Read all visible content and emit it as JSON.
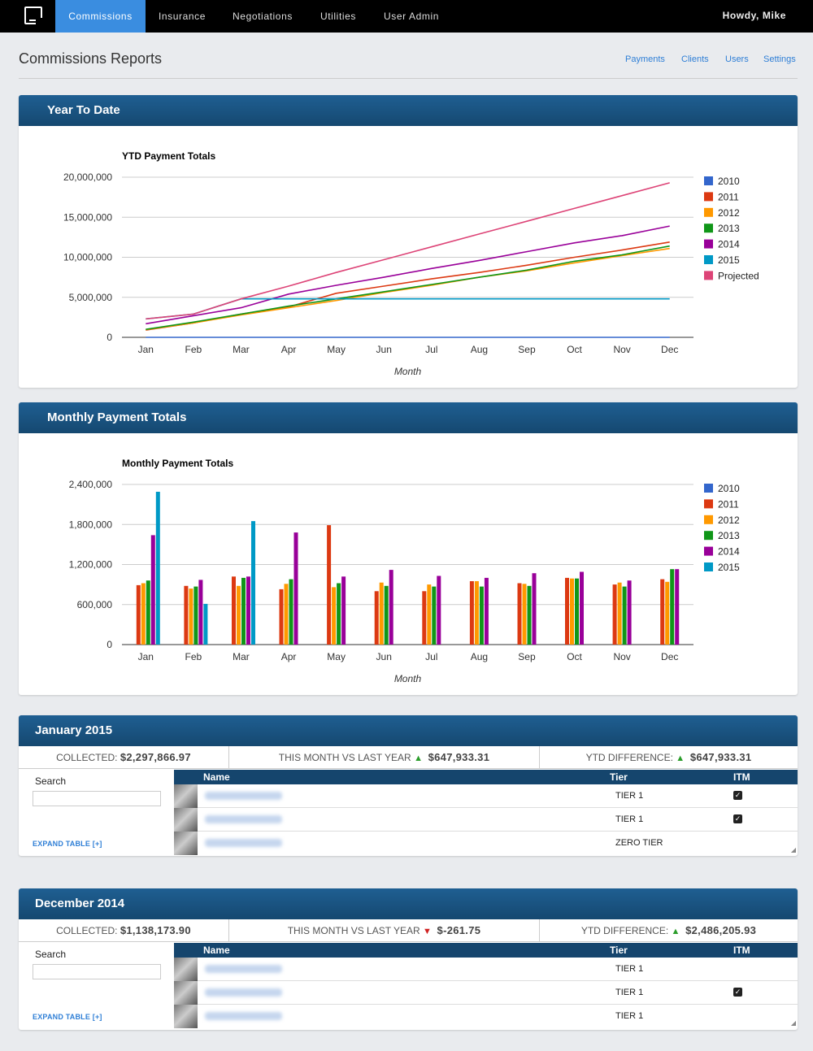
{
  "nav": {
    "items": [
      "Commissions",
      "Insurance",
      "Negotiations",
      "Utilities",
      "User Admin"
    ],
    "greeting": "Howdy, Mike"
  },
  "header": {
    "title": "Commissions Reports",
    "links": [
      "Payments",
      "Clients",
      "Users",
      "Settings"
    ]
  },
  "colors": {
    "2010": "#3366cc",
    "2011": "#dc3912",
    "2012": "#ff9900",
    "2013": "#109618",
    "2014": "#990099",
    "2015": "#0099c6",
    "Projected": "#dd4477"
  },
  "ytd_panel": {
    "title": "Year To Date"
  },
  "monthly_panel": {
    "title": "Monthly Payment Totals"
  },
  "chart_data": [
    {
      "type": "line",
      "title": "YTD Payment Totals",
      "xlabel": "Month",
      "ylabel": "",
      "categories": [
        "Jan",
        "Feb",
        "Mar",
        "Apr",
        "May",
        "Jun",
        "Jul",
        "Aug",
        "Sep",
        "Oct",
        "Nov",
        "Dec"
      ],
      "ylim": [
        0,
        20000000
      ],
      "yticks": [
        0,
        5000000,
        10000000,
        15000000,
        20000000
      ],
      "ytick_labels": [
        "0",
        "5,000,000",
        "10,000,000",
        "15,000,000",
        "20,000,000"
      ],
      "legend": "right",
      "series": [
        {
          "name": "2010",
          "values": [
            0,
            0,
            0,
            0,
            0,
            0,
            0,
            0,
            0,
            0,
            0,
            0
          ]
        },
        {
          "name": "2011",
          "values": [
            900000,
            1800000,
            2900000,
            3800000,
            5500000,
            6400000,
            7300000,
            8100000,
            9000000,
            10000000,
            10900000,
            11900000
          ]
        },
        {
          "name": "2012",
          "values": [
            950000,
            1800000,
            2800000,
            3700000,
            4600000,
            5600000,
            6500000,
            7500000,
            8300000,
            9300000,
            10200000,
            11100000
          ]
        },
        {
          "name": "2013",
          "values": [
            1000000,
            1900000,
            2900000,
            3900000,
            4800000,
            5700000,
            6600000,
            7500000,
            8400000,
            9500000,
            10300000,
            11400000
          ]
        },
        {
          "name": "2014",
          "values": [
            1700000,
            2700000,
            3700000,
            5400000,
            6500000,
            7500000,
            8600000,
            9600000,
            10700000,
            11800000,
            12700000,
            13900000
          ]
        },
        {
          "name": "2015",
          "values": [
            2300000,
            2900000,
            4800000,
            4800000,
            4800000,
            4800000,
            4800000,
            4800000,
            4800000,
            4800000,
            4800000,
            4800000
          ]
        },
        {
          "name": "Projected",
          "values": [
            2300000,
            2900000,
            4800000,
            6400000,
            8100000,
            9700000,
            11300000,
            12900000,
            14500000,
            16100000,
            17700000,
            19300000
          ]
        }
      ]
    },
    {
      "type": "bar",
      "title": "Monthly Payment Totals",
      "xlabel": "Month",
      "ylabel": "",
      "categories": [
        "Jan",
        "Feb",
        "Mar",
        "Apr",
        "May",
        "Jun",
        "Jul",
        "Aug",
        "Sep",
        "Oct",
        "Nov",
        "Dec"
      ],
      "ylim": [
        0,
        2400000
      ],
      "yticks": [
        0,
        600000,
        1200000,
        1800000,
        2400000
      ],
      "ytick_labels": [
        "0",
        "600,000",
        "1,200,000",
        "1,800,000",
        "2,400,000"
      ],
      "legend": "right",
      "series": [
        {
          "name": "2010",
          "values": [
            0,
            0,
            0,
            0,
            0,
            0,
            0,
            0,
            0,
            0,
            0,
            0
          ]
        },
        {
          "name": "2011",
          "values": [
            890000,
            880000,
            1020000,
            830000,
            1790000,
            800000,
            800000,
            950000,
            920000,
            1000000,
            900000,
            980000
          ]
        },
        {
          "name": "2012",
          "values": [
            920000,
            840000,
            880000,
            910000,
            860000,
            930000,
            900000,
            950000,
            910000,
            990000,
            930000,
            940000
          ]
        },
        {
          "name": "2013",
          "values": [
            960000,
            870000,
            1000000,
            980000,
            920000,
            880000,
            870000,
            870000,
            880000,
            990000,
            870000,
            1130000
          ]
        },
        {
          "name": "2014",
          "values": [
            1640000,
            970000,
            1020000,
            1680000,
            1020000,
            1120000,
            1030000,
            1000000,
            1070000,
            1090000,
            960000,
            1130000
          ]
        },
        {
          "name": "2015",
          "values": [
            2290000,
            610000,
            1850000,
            0,
            0,
            0,
            0,
            0,
            0,
            0,
            0,
            0
          ]
        }
      ]
    }
  ],
  "jan2015": {
    "title": "January 2015",
    "collected_label": "COLLECTED:",
    "collected_value": "$2,297,866.97",
    "vs_label": "THIS MONTH VS LAST YEAR",
    "vs_value": "$647,933.31",
    "vs_dir": "up",
    "ytd_label": "YTD DIFFERENCE:",
    "ytd_value": "$647,933.31",
    "search_label": "Search",
    "expand_label": "EXPAND TABLE [+]",
    "columns": [
      "Name",
      "Tier",
      "ITM"
    ],
    "rows": [
      {
        "tier": "TIER 1",
        "itm": true
      },
      {
        "tier": "TIER 1",
        "itm": true
      },
      {
        "tier": "ZERO TIER",
        "itm": false
      }
    ]
  },
  "dec2014": {
    "title": "December 2014",
    "collected_label": "COLLECTED:",
    "collected_value": "$1,138,173.90",
    "vs_label": "THIS MONTH VS LAST YEAR",
    "vs_value": "$-261.75",
    "vs_dir": "down",
    "ytd_label": "YTD DIFFERENCE:",
    "ytd_value": "$2,486,205.93",
    "search_label": "Search",
    "expand_label": "EXPAND TABLE [+]",
    "columns": [
      "Name",
      "Tier",
      "ITM"
    ],
    "rows": [
      {
        "tier": "TIER 1",
        "itm": false
      },
      {
        "tier": "TIER 1",
        "itm": true
      },
      {
        "tier": "TIER 1",
        "itm": false
      }
    ]
  }
}
